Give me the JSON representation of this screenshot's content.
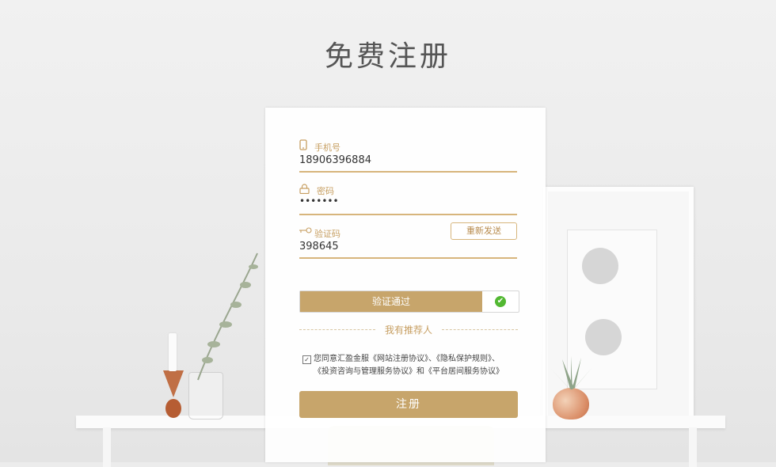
{
  "page": {
    "title": "免费注册"
  },
  "form": {
    "phone": {
      "label": "手机号",
      "value": "18906396884"
    },
    "password": {
      "label": "密码",
      "value": "•••••••"
    },
    "code": {
      "label": "验证码",
      "value": "398645",
      "resend_label": "重新发送"
    },
    "verify": {
      "label": "验证通过",
      "status_icon": "check-icon"
    },
    "referrer": {
      "label": "我有推荐人"
    },
    "agreement": {
      "checked": true,
      "line1": "您同意汇盈金服《网站注册协议》、《隐私保护规则》、",
      "line2": "《投资咨询与管理服务协议》和《平台居间服务协议》"
    },
    "submit_label": "注册"
  },
  "colors": {
    "accent": "#c7a56b",
    "success": "#52b832"
  }
}
